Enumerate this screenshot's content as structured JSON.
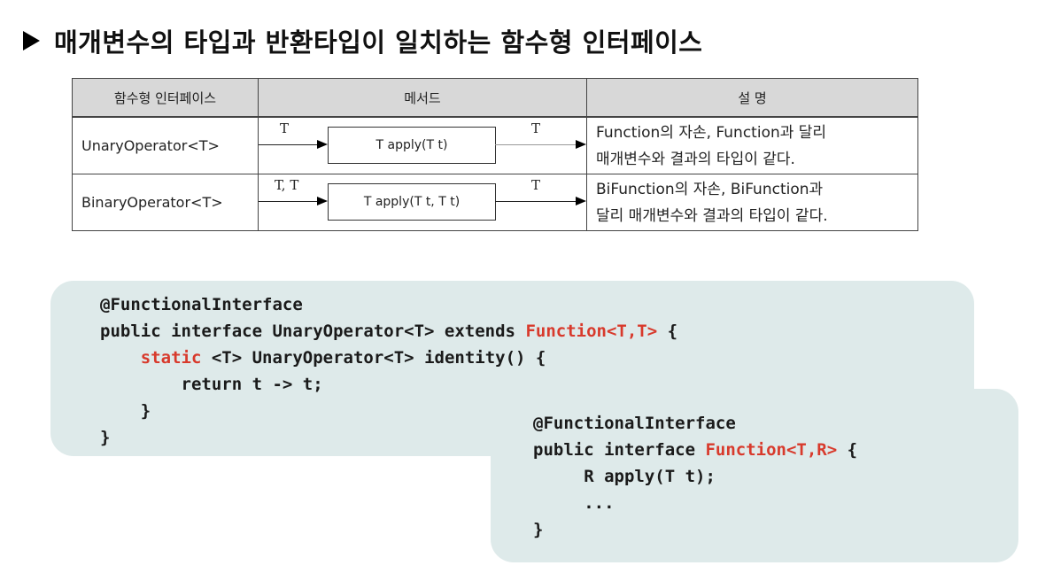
{
  "heading": {
    "bullet_icon": "right-triangle-icon",
    "title": "매개변수의 타입과 반환타입이 일치하는 함수형 인터페이스"
  },
  "table": {
    "headers": [
      "함수형 인터페이스",
      "메서드",
      "설 명"
    ],
    "rows": [
      {
        "name": "UnaryOperator<T>",
        "input": "T",
        "method": "T apply(T t)",
        "output": "T",
        "desc_line1": "Function의 자손, Function과 달리",
        "desc_line2": "매개변수와 결과의 타입이 같다."
      },
      {
        "name": "BinaryOperator<T>",
        "input": "T, T",
        "method": "T apply(T t, T t)",
        "output": "T",
        "desc_line1": "BiFunction의 자손, BiFunction과",
        "desc_line2": "달리 매개변수와 결과의 타입이 같다."
      }
    ]
  },
  "code1": {
    "annotation": "@FunctionalInterface",
    "decl_prefix": "public interface UnaryOperator<T> extends ",
    "decl_highlight": "Function<T,T>",
    "decl_suffix": " {",
    "static_kw": "static",
    "method_sig": " <T> UnaryOperator<T> identity() {",
    "body": "return t -> t;",
    "close_inner": "}",
    "close_outer": "}"
  },
  "code2": {
    "annotation": "@FunctionalInterface",
    "decl_prefix": "public interface ",
    "decl_highlight": "Function<T,R>",
    "decl_suffix": " {",
    "method": "R apply(T t);",
    "ellipsis": "...",
    "close": "}"
  },
  "colors": {
    "highlight": "#d83a2c",
    "code_bg": "#deeaea",
    "header_bg": "#d8d8d8"
  }
}
